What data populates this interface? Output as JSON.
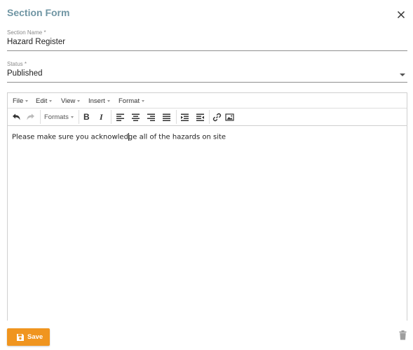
{
  "dialog": {
    "title": "Section Form",
    "close_icon": "close-icon"
  },
  "fields": {
    "section_name": {
      "label": "Section Name *",
      "value": "Hazard Register"
    },
    "status": {
      "label": "Status *",
      "value": "Published",
      "icon": "chevron-down-icon"
    }
  },
  "editor": {
    "menus": [
      "File",
      "Edit",
      "View",
      "Insert",
      "Format"
    ],
    "toolbar": {
      "formats_label": "Formats",
      "bold_label": "B",
      "italic_label": "I",
      "icons": [
        "undo-icon",
        "redo-icon",
        "align-left-icon",
        "align-center-icon",
        "align-right-icon",
        "align-justify-icon",
        "outdent-icon",
        "indent-icon",
        "link-icon",
        "image-icon"
      ]
    },
    "content_before_caret": "Please make sure you acknowled",
    "content_after_caret": "ge all of the hazards on site"
  },
  "footer": {
    "save_label": "Save",
    "save_color": "#f0951f",
    "delete_icon": "trash-icon"
  },
  "colors": {
    "title": "#6f95a3",
    "accent": "#f0951f"
  }
}
